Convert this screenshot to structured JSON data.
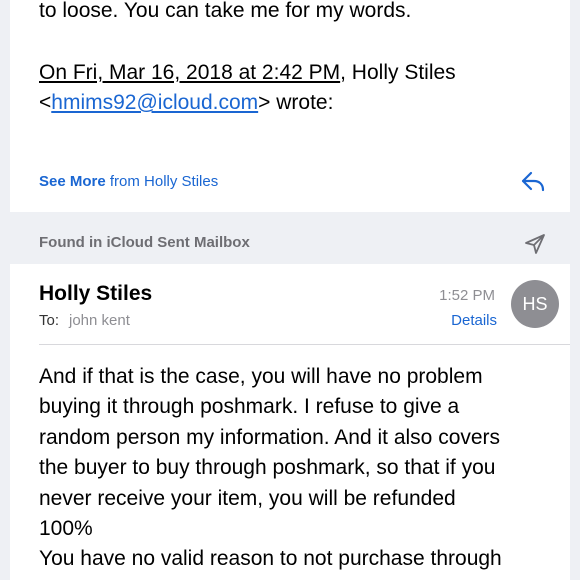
{
  "quoted": {
    "line1": "to loose. You can take me for my words.",
    "date_prefix": "On Fri, Mar 16, 2018 at 2:42 PM",
    "date_suffix": ", Holly Stiles",
    "lt": "<",
    "email": "hmims92@icloud.com",
    "gt_wrote": "> wrote:"
  },
  "see_more": {
    "prefix": "See More",
    "suffix": " from Holly Stiles"
  },
  "found_in": "Found in iCloud Sent Mailbox",
  "message": {
    "sender": "Holly Stiles",
    "to_label": "To:",
    "to_name": "john kent",
    "time": "1:52 PM",
    "details_label": "Details",
    "avatar_initials": "HS",
    "body_lines": [
      "And if that is the case, you will have no problem",
      "buying it through poshmark. I refuse to give a",
      "random person my information. And it also covers",
      "the buyer to buy through poshmark, so that if you",
      "never receive your item, you will be refunded",
      "100%",
      "You have no valid reason to not purchase through"
    ]
  },
  "icons": {
    "reply": "reply-icon",
    "send": "send-icon"
  },
  "colors": {
    "accent": "#1a66d2",
    "muted": "#8e8e93",
    "background_gray": "#eef0f4",
    "avatar": "#8e8e93"
  }
}
